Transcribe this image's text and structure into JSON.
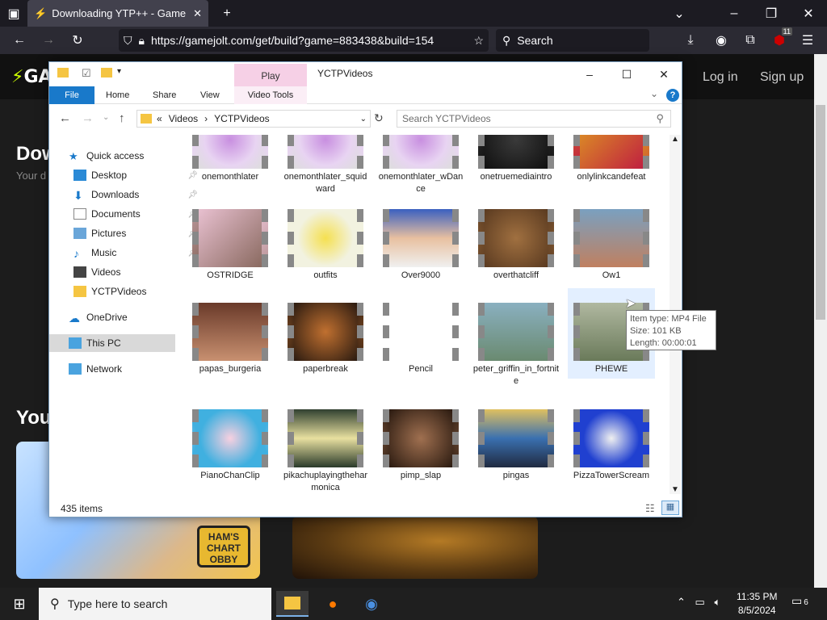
{
  "browser": {
    "tab_title": "Downloading YTP++ - Game Jol",
    "url": "https://gamejolt.com/get/build?game=883438&build=154",
    "search_placeholder": "Search",
    "extension_badge": "11"
  },
  "site": {
    "logo": "GA",
    "login": "Log in",
    "signup": "Sign up",
    "download_heading": "Dow",
    "download_sub": "Your d",
    "you_heading": "You",
    "card1_badge": "HAM'S CHART OBBY"
  },
  "explorer": {
    "play_tab": "Play",
    "window_title": "YCTPVideos",
    "tabs": {
      "file": "File",
      "home": "Home",
      "share": "Share",
      "view": "View",
      "video_tools": "Video Tools"
    },
    "breadcrumb": {
      "prefix": "«",
      "part1": "Videos",
      "sep": "›",
      "part2": "YCTPVideos"
    },
    "search_placeholder": "Search YCTPVideos",
    "nav": {
      "quick_access": "Quick access",
      "desktop": "Desktop",
      "downloads": "Downloads",
      "documents": "Documents",
      "pictures": "Pictures",
      "music": "Music",
      "videos": "Videos",
      "yctpvideos": "YCTPVideos",
      "onedrive": "OneDrive",
      "this_pc": "This PC",
      "network": "Network"
    },
    "files": [
      "onemonthlater",
      "onemonthlater_squidward",
      "onemonthlater_wDance",
      "onetruemediaintro",
      "onlylinkcandefeat",
      "OSTRIDGE",
      "outfits",
      "Over9000",
      "overthatcliff",
      "Ow1",
      "papas_burgeria",
      "paperbreak",
      "Pencil",
      "peter_griffin_in_fortnite",
      "PHEWE",
      "PianoChanClip",
      "pikachuplayingtheharmonica",
      "pimp_slap",
      "pingas",
      "PizzaTowerScream"
    ],
    "selected_file": "PHEWE",
    "status": "435 items",
    "tooltip": {
      "type": "Item type: MP4 File",
      "size": "Size: 101 KB",
      "length": "Length: 00:00:01"
    }
  },
  "taskbar": {
    "search_placeholder": "Type here to search",
    "time": "11:35 PM",
    "date": "8/5/2024",
    "notifications": "6"
  },
  "colors": {
    "file_tab": "#1979ca",
    "play_tab": "#f6d0e6",
    "selection": "#e3efff",
    "taskbar": "#1f1f1f"
  }
}
